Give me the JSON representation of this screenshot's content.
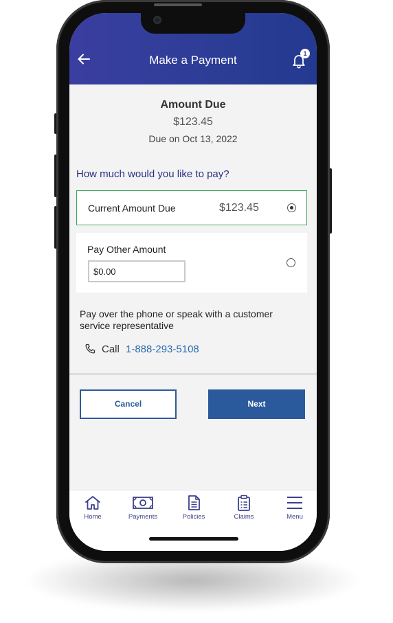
{
  "header": {
    "title": "Make a Payment",
    "notification_count": "1"
  },
  "summary": {
    "title": "Amount Due",
    "amount": "$123.45",
    "due_date": "Due on Oct 13, 2022"
  },
  "question": "How much would you like to pay?",
  "options": {
    "current": {
      "label": "Current Amount Due",
      "amount": "$123.45",
      "selected": true
    },
    "other": {
      "label": "Pay Other Amount",
      "input_value": "$0.00",
      "selected": false
    }
  },
  "contact": {
    "text": "Pay over the phone or speak with a customer service representative",
    "call_label": "Call",
    "phone_number": "1-888-293-5108"
  },
  "buttons": {
    "cancel": "Cancel",
    "next": "Next"
  },
  "tabs": [
    {
      "label": "Home",
      "icon": "home-icon"
    },
    {
      "label": "Payments",
      "icon": "payments-icon"
    },
    {
      "label": "Policies",
      "icon": "policies-icon"
    },
    {
      "label": "Claims",
      "icon": "claims-icon"
    },
    {
      "label": "Menu",
      "icon": "menu-icon"
    }
  ],
  "colors": {
    "header": "#2c3d96",
    "accent": "#2a5a9c",
    "selected_border": "#3aa655",
    "link": "#2a6cb0"
  }
}
